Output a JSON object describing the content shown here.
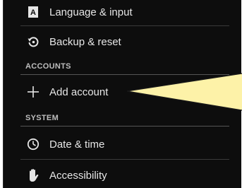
{
  "settings": {
    "items": [
      {
        "label": "Language & input",
        "icon": "language-icon"
      },
      {
        "label": "Backup & reset",
        "icon": "backup-reset-icon"
      },
      {
        "label": "Add account",
        "icon": "plus-icon"
      },
      {
        "label": "Date & time",
        "icon": "clock-icon"
      },
      {
        "label": "Accessibility",
        "icon": "hand-icon"
      }
    ],
    "headers": {
      "accounts": "ACCOUNTS",
      "system": "SYSTEM"
    }
  },
  "colors": {
    "background": "#0d0d0d",
    "text": "#e6e6e6",
    "header_text": "#bdbdbd",
    "callout": "#fdf2a8"
  }
}
